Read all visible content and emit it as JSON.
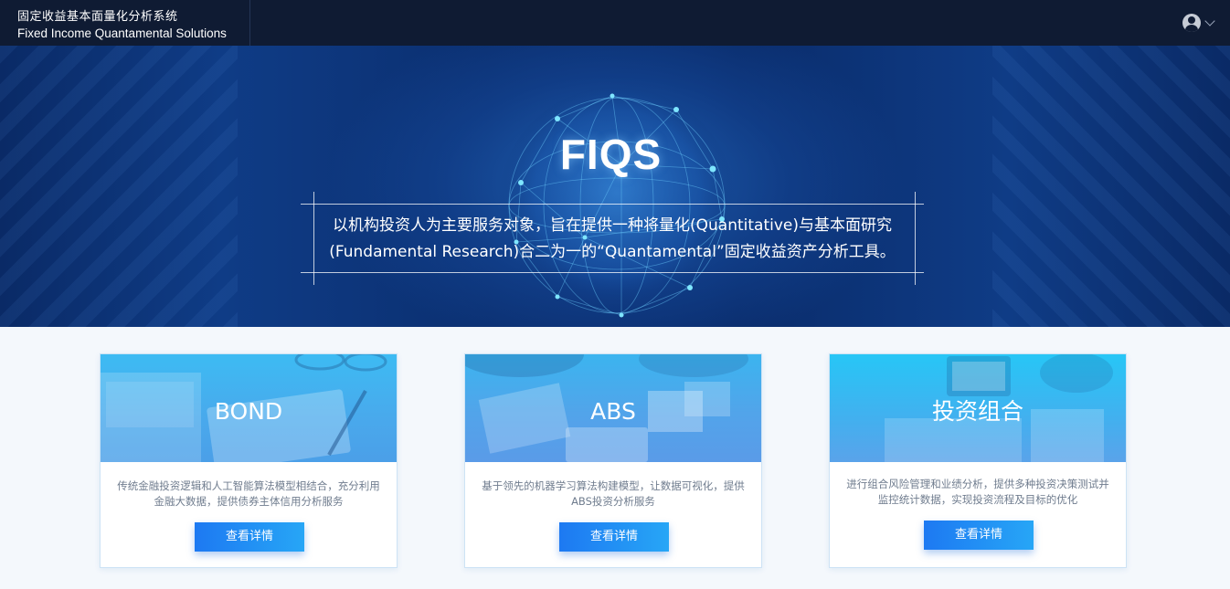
{
  "header": {
    "title_cn": "固定收益基本面量化分析系统",
    "title_en": "Fixed Income Quantamental Solutions",
    "user_icon": "user-avatar-icon",
    "menu_icon": "chevron-down-icon"
  },
  "hero": {
    "title": "FIQS",
    "tagline_line1": "以机构投资人为主要服务对象，旨在提供一种将量化(Quantitative)与基本面研究",
    "tagline_line2": "(Fundamental Research)合二为一的“Quantamental”固定收益资产分析工具。"
  },
  "cards": [
    {
      "title": "BOND",
      "description": "传统金融投资逻辑和人工智能算法模型相结合，充分利用金融大数据，提供债券主体信用分析服务",
      "button": "查看详情"
    },
    {
      "title": "ABS",
      "description": "基于领先的机器学习算法构建模型，让数据可视化，提供ABS投资分析服务",
      "button": "查看详情"
    },
    {
      "title": "投资组合",
      "description": "进行组合风险管理和业绩分析，提供多种投资决策测试并监控统计数据，实现投资流程及目标的优化",
      "button": "查看详情"
    }
  ],
  "colors": {
    "topbar": "#0f1b33",
    "button_start": "#1d79f2",
    "button_end": "#27a6f6",
    "card_border": "#cde3f5"
  }
}
